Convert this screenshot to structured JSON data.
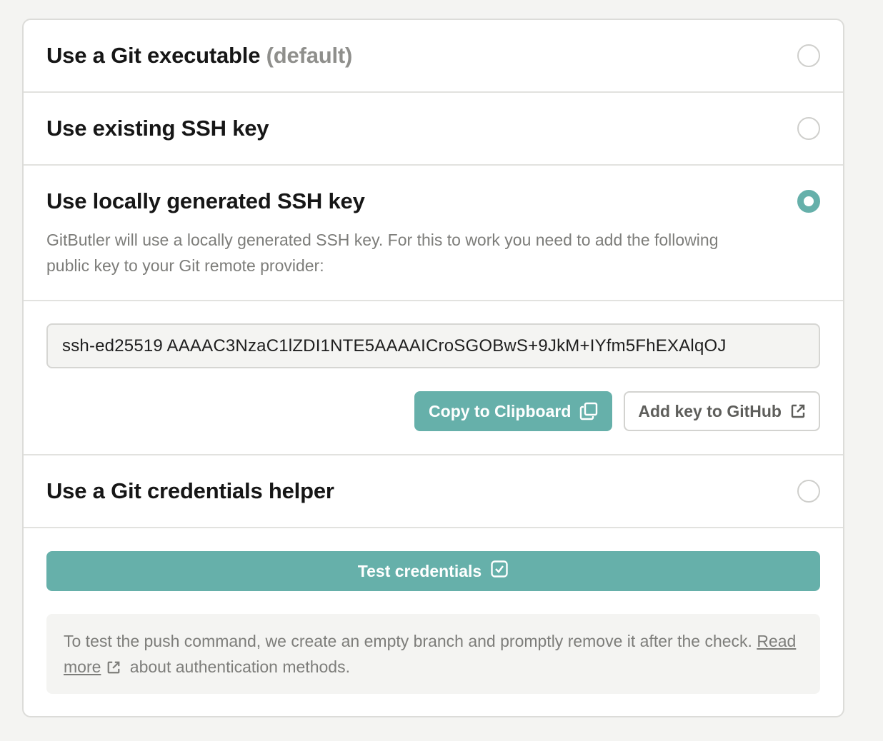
{
  "options": [
    {
      "title": "Use a Git executable",
      "suffix": "(default)",
      "selected": false
    },
    {
      "title": "Use existing SSH key",
      "selected": false
    },
    {
      "title": "Use locally generated SSH key",
      "selected": true,
      "description": "GitButler will use a locally generated SSH key. For this to work you need to add the following public key to your Git remote provider:"
    },
    {
      "title": "Use a Git credentials helper",
      "selected": false
    }
  ],
  "ssh_key": {
    "value": "ssh-ed25519 AAAAC3NzaC1lZDI1NTE5AAAAICroSGOBwS+9JkM+IYfm5FhEXAlqOJ"
  },
  "buttons": {
    "copy_label": "Copy to Clipboard",
    "add_key_label": "Add key to GitHub",
    "test_label": "Test credentials"
  },
  "note": {
    "text_before": "To test the push command, we create an empty branch and promptly remove it after the check.",
    "link_label": "Read more",
    "text_after": "about authentication methods."
  },
  "colors": {
    "accent": "#66b0aa",
    "background": "#f4f4f2",
    "muted_text": "#7d7d7a"
  }
}
